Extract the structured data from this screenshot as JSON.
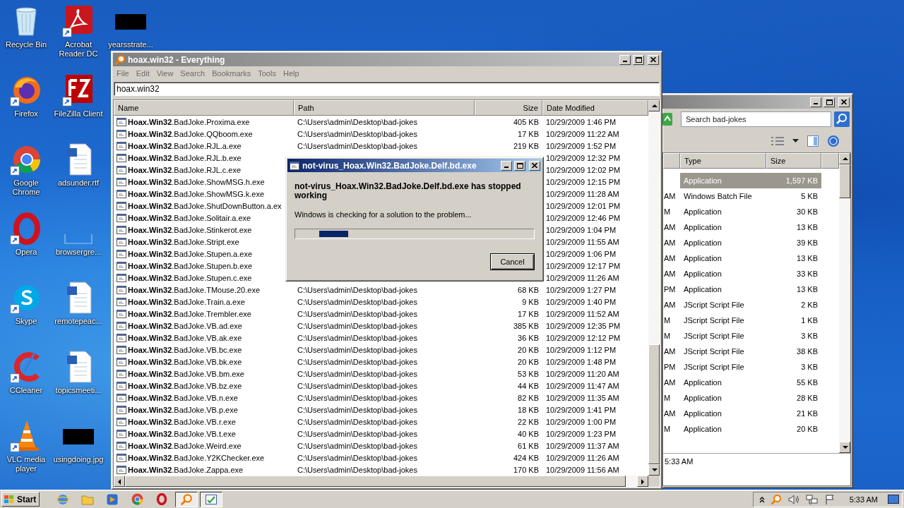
{
  "desktop_icons": [
    {
      "kind": "recycle",
      "label": "Recycle Bin"
    },
    {
      "kind": "firefox",
      "label": "Firefox",
      "shortcut": true
    },
    {
      "kind": "chrome",
      "label": "Google Chrome",
      "shortcut": true
    },
    {
      "kind": "opera",
      "label": "Opera",
      "shortcut": true
    },
    {
      "kind": "skype",
      "label": "Skype",
      "shortcut": true
    },
    {
      "kind": "ccleaner",
      "label": "CCleaner",
      "shortcut": true
    },
    {
      "kind": "vlc",
      "label": "VLC media player",
      "shortcut": true
    },
    {
      "kind": "pdf",
      "label": "Acrobat Reader DC",
      "shortcut": true
    },
    {
      "kind": "filezilla",
      "label": "FileZilla Client",
      "shortcut": true
    },
    {
      "kind": "document",
      "label": "adsunder.rtf"
    },
    {
      "kind": "blank",
      "label": "browsergre..."
    },
    {
      "kind": "document",
      "label": "remotepeac..."
    },
    {
      "kind": "document",
      "label": "topicsmeeti..."
    },
    {
      "kind": "thumbnail",
      "label": "usingdoing.jpg"
    },
    {
      "kind": "thumbnail",
      "label": "yearsstrate..."
    }
  ],
  "everything_window": {
    "title": "hoax.win32 - Everything",
    "menu": [
      "File",
      "Edit",
      "View",
      "Search",
      "Bookmarks",
      "Tools",
      "Help"
    ],
    "search": "hoax.win32",
    "columns": [
      "Name",
      "Path",
      "Size",
      "Date Modified"
    ],
    "rows": [
      {
        "name": "**Hoax.Win32**.BadJoke.Proxima.exe",
        "path": "C:\\Users\\admin\\Desktop\\bad-jokes",
        "size": "405 KB",
        "date": "10/29/2009 1:46 PM",
        "selected": false
      },
      {
        "name": "**Hoax.Win32**.BadJoke.QQboom.exe",
        "path": "C:\\Users\\admin\\Desktop\\bad-jokes",
        "size": "17 KB",
        "date": "10/29/2009 11:22 AM",
        "selected": false
      },
      {
        "name": "**Hoax.Win32**.BadJoke.RJL.a.exe",
        "path": "C:\\Users\\admin\\Desktop\\bad-jokes",
        "size": "219 KB",
        "date": "10/29/2009 1:52 PM",
        "selected": false
      },
      {
        "name": "**Hoax.Win32**.BadJoke.RJL.b.exe",
        "date": "10/29/2009 12:32 PM",
        "selected": false
      },
      {
        "name": "**Hoax.Win32**.BadJoke.RJL.c.exe",
        "date": "10/29/2009 12:02 PM",
        "selected": false
      },
      {
        "name": "**Hoax.Win32**.BadJoke.ShowMSG.h.exe",
        "date": "10/29/2009 12:15 PM",
        "selected": false
      },
      {
        "name": "**Hoax.Win32**.BadJoke.ShowMSG.k.exe",
        "date": "10/29/2009 11:28 AM",
        "selected": false
      },
      {
        "name": "**Hoax.Win32**.BadJoke.ShutDownButton.a.ex",
        "date": "10/29/2009 12:01 PM",
        "selected": false
      },
      {
        "name": "**Hoax.Win32**.BadJoke.Solitair.a.exe",
        "date": "10/29/2009 12:46 PM",
        "selected": false
      },
      {
        "name": "**Hoax.Win32**.BadJoke.Stinkerot.exe",
        "date": "10/29/2009 1:04 PM",
        "selected": false
      },
      {
        "name": "**Hoax.Win32**.BadJoke.Stript.exe",
        "date": "10/29/2009 11:55 AM",
        "selected": false
      },
      {
        "name": "**Hoax.Win32**.BadJoke.Stupen.a.exe",
        "date": "10/29/2009 1:06 PM",
        "selected": false
      },
      {
        "name": "**Hoax.Win32**.BadJoke.Stupen.b.exe",
        "date": "10/29/2009 12:17 PM",
        "selected": false
      },
      {
        "name": "**Hoax.Win32**.BadJoke.Stupen.c.exe",
        "date": "10/29/2009 11:26 AM",
        "selected": false
      },
      {
        "name": "**Hoax.Win32**.BadJoke.TMouse.20.exe",
        "path": "C:\\Users\\admin\\Desktop\\bad-jokes",
        "size": "68 KB",
        "date": "10/29/2009 1:27 PM",
        "selected": false
      },
      {
        "name": "**Hoax.Win32**.BadJoke.Train.a.exe",
        "path": "C:\\Users\\admin\\Desktop\\bad-jokes",
        "size": "9 KB",
        "date": "10/29/2009 1:40 PM",
        "selected": false
      },
      {
        "name": "**Hoax.Win32**.BadJoke.Trembler.exe",
        "path": "C:\\Users\\admin\\Desktop\\bad-jokes",
        "size": "17 KB",
        "date": "10/29/2009 11:52 AM",
        "selected": false
      },
      {
        "name": "**Hoax.Win32**.BadJoke.VB.ad.exe",
        "path": "C:\\Users\\admin\\Desktop\\bad-jokes",
        "size": "385 KB",
        "date": "10/29/2009 12:35 PM",
        "selected": false
      },
      {
        "name": "**Hoax.Win32**.BadJoke.VB.ak.exe",
        "path": "C:\\Users\\admin\\Desktop\\bad-jokes",
        "size": "36 KB",
        "date": "10/29/2009 12:12 PM",
        "selected": false
      },
      {
        "name": "**Hoax.Win32**.BadJoke.VB.bc.exe",
        "path": "C:\\Users\\admin\\Desktop\\bad-jokes",
        "size": "20 KB",
        "date": "10/29/2009 1:12 PM",
        "selected": false
      },
      {
        "name": "**Hoax.Win32**.BadJoke.VB.bk.exe",
        "path": "C:\\Users\\admin\\Desktop\\bad-jokes",
        "size": "20 KB",
        "date": "10/29/2009 1:48 PM",
        "selected": false
      },
      {
        "name": "**Hoax.Win32**.BadJoke.VB.bm.exe",
        "path": "C:\\Users\\admin\\Desktop\\bad-jokes",
        "size": "53 KB",
        "date": "10/29/2009 11:20 AM",
        "selected": false
      },
      {
        "name": "**Hoax.Win32**.BadJoke.VB.bz.exe",
        "path": "C:\\Users\\admin\\Desktop\\bad-jokes",
        "size": "44 KB",
        "date": "10/29/2009 11:47 AM",
        "selected": false
      },
      {
        "name": "**Hoax.Win32**.BadJoke.VB.n.exe",
        "path": "C:\\Users\\admin\\Desktop\\bad-jokes",
        "size": "82 KB",
        "date": "10/29/2009 11:35 AM",
        "selected": false
      },
      {
        "name": "**Hoax.Win32**.BadJoke.VB.p.exe",
        "path": "C:\\Users\\admin\\Desktop\\bad-jokes",
        "size": "18 KB",
        "date": "10/29/2009 1:41 PM",
        "selected": false
      },
      {
        "name": "**Hoax.Win32**.BadJoke.VB.r.exe",
        "path": "C:\\Users\\admin\\Desktop\\bad-jokes",
        "size": "22 KB",
        "date": "10/29/2009 1:00 PM",
        "selected": false
      },
      {
        "name": "**Hoax.Win32**.BadJoke.VB.t.exe",
        "path": "C:\\Users\\admin\\Desktop\\bad-jokes",
        "size": "40 KB",
        "date": "10/29/2009 1:23 PM",
        "selected": false
      },
      {
        "name": "**Hoax.Win32**.BadJoke.Weird.exe",
        "path": "C:\\Users\\admin\\Desktop\\bad-jokes",
        "size": "61 KB",
        "date": "10/29/2009 11:37 AM",
        "selected": false
      },
      {
        "name": "**Hoax.Win32**.BadJoke.Y2KChecker.exe",
        "path": "C:\\Users\\admin\\Desktop\\bad-jokes",
        "size": "424 KB",
        "date": "10/29/2009 11:26 AM",
        "selected": false
      },
      {
        "name": "**Hoax.Win32**.BadJoke.Zappa.exe",
        "path": "C:\\Users\\admin\\Desktop\\bad-jokes",
        "size": "170 KB",
        "date": "10/29/2009 11:56 AM",
        "selected": false
      }
    ]
  },
  "error_dialog": {
    "title": "not-virus_Hoax.Win32.BadJoke.Delf.bd.exe",
    "heading": "not-virus_Hoax.Win32.BadJoke.Delf.bd.exe has stopped working",
    "message": "Windows is checking for a solution to the problem...",
    "progress": {
      "level": 0.12
    },
    "button": "Cancel"
  },
  "explorer_window": {
    "search": {
      "placeholder": "Search bad-jokes"
    },
    "columns": [
      "Type",
      "Size"
    ],
    "rows": [
      {
        "type": "Application",
        "size": "1,597 KB",
        "selected": true
      },
      {
        "time": "AM",
        "type": "Windows Batch File",
        "size": "5 KB",
        "selected": false
      },
      {
        "time": "M",
        "type": "Application",
        "size": "30 KB",
        "selected": false
      },
      {
        "time": "AM",
        "type": "Application",
        "size": "13 KB",
        "selected": false
      },
      {
        "time": "AM",
        "type": "Application",
        "size": "39 KB",
        "selected": false
      },
      {
        "time": "AM",
        "type": "Application",
        "size": "13 KB",
        "selected": false
      },
      {
        "time": "AM",
        "type": "Application",
        "size": "33 KB",
        "selected": false
      },
      {
        "time": "PM",
        "type": "Application",
        "size": "13 KB",
        "selected": false
      },
      {
        "time": "AM",
        "type": "JScript Script File",
        "size": "2 KB",
        "selected": false
      },
      {
        "time": "M",
        "type": "JScript Script File",
        "size": "1 KB",
        "selected": false
      },
      {
        "time": "M",
        "type": "JScript Script File",
        "size": "3 KB",
        "selected": false
      },
      {
        "time": "AM",
        "type": "JScript Script File",
        "size": "38 KB",
        "selected": false
      },
      {
        "time": "PM",
        "type": "JScript Script File",
        "size": "3 KB",
        "selected": false
      },
      {
        "time": "AM",
        "type": "Application",
        "size": "55 KB",
        "selected": false
      },
      {
        "time": "M",
        "type": "Application",
        "size": "28 KB",
        "selected": false
      },
      {
        "time": "AM",
        "type": "Application",
        "size": "21 KB",
        "selected": false
      },
      {
        "time": "M",
        "type": "Application",
        "size": "20 KB",
        "selected": false
      }
    ],
    "status": "5:33 AM"
  },
  "taskbar": {
    "start": "Start",
    "apps": [
      {
        "kind": "ie",
        "active": false
      },
      {
        "kind": "folder",
        "active": false
      },
      {
        "kind": "media",
        "active": false
      },
      {
        "kind": "chrome",
        "active": false
      },
      {
        "kind": "opera",
        "active": false
      },
      {
        "kind": "everything",
        "active": true
      },
      {
        "kind": "app",
        "active": true
      }
    ],
    "clock": "5:33 AM"
  }
}
